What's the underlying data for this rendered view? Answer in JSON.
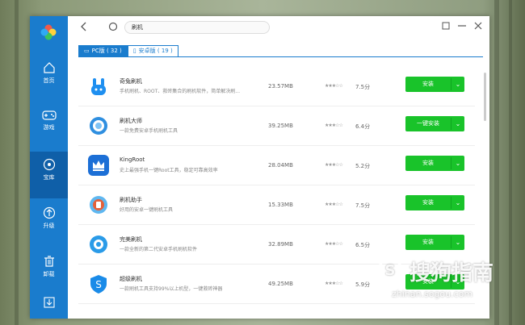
{
  "sidebar": {
    "items": [
      {
        "label": "首页",
        "icon": "home-icon"
      },
      {
        "label": "游戏",
        "icon": "gamepad-icon"
      },
      {
        "label": "宝库",
        "icon": "disc-icon",
        "active": true
      },
      {
        "label": "升级",
        "icon": "upgrade-icon"
      },
      {
        "label": "卸载",
        "icon": "trash-icon"
      },
      {
        "label": "",
        "icon": "download-icon"
      }
    ]
  },
  "topbar": {
    "search_value": "刷机",
    "back_icon": "back-icon",
    "refresh_icon": "refresh-icon"
  },
  "tabs": [
    {
      "label": "PC版 ( 32 )",
      "icon": "monitor-icon",
      "active": true
    },
    {
      "label": "安卓版 ( 19 )",
      "icon": "phone-icon",
      "active": false
    }
  ],
  "apps": [
    {
      "name": "奇兔刷机",
      "desc": "手机刷机、ROOT、救砖集合的刷机软件，简单解决刷...",
      "size": "23.57MB",
      "score": "7.5分",
      "button": "安装",
      "color": "#1e8ff0"
    },
    {
      "name": "刷机大师",
      "desc": "一款免费安卓手机刷机工具",
      "size": "39.25MB",
      "score": "6.4分",
      "button": "一键安装",
      "color": "#2f8fe0"
    },
    {
      "name": "KingRoot",
      "desc": "史上最强手机一键Root工具，稳定可靠高效率",
      "size": "28.04MB",
      "score": "5.2分",
      "button": "安装",
      "color": "#1c6fd6"
    },
    {
      "name": "刷机助手",
      "desc": "好用的安卓一键刷机工具",
      "size": "15.33MB",
      "score": "7.5分",
      "button": "安装",
      "color": "#e4603a"
    },
    {
      "name": "完美刷机",
      "desc": "一款全新的第二代安卓手机刷机软件",
      "size": "32.89MB",
      "score": "6.5分",
      "button": "安装",
      "color": "#2a9be8"
    },
    {
      "name": "超级刷机",
      "desc": "一款刷机工具支持99%以上机型，一键救砖神器",
      "size": "49.25MB",
      "score": "5.9分",
      "button": "安装",
      "color": "#1a8be8"
    }
  ],
  "stars_glyph": "★★★☆☆",
  "dropdown_glyph": "⌄",
  "watermark": {
    "cn": "搜狗指南",
    "en": "zhinan.sogou.com",
    "logo": "S"
  }
}
